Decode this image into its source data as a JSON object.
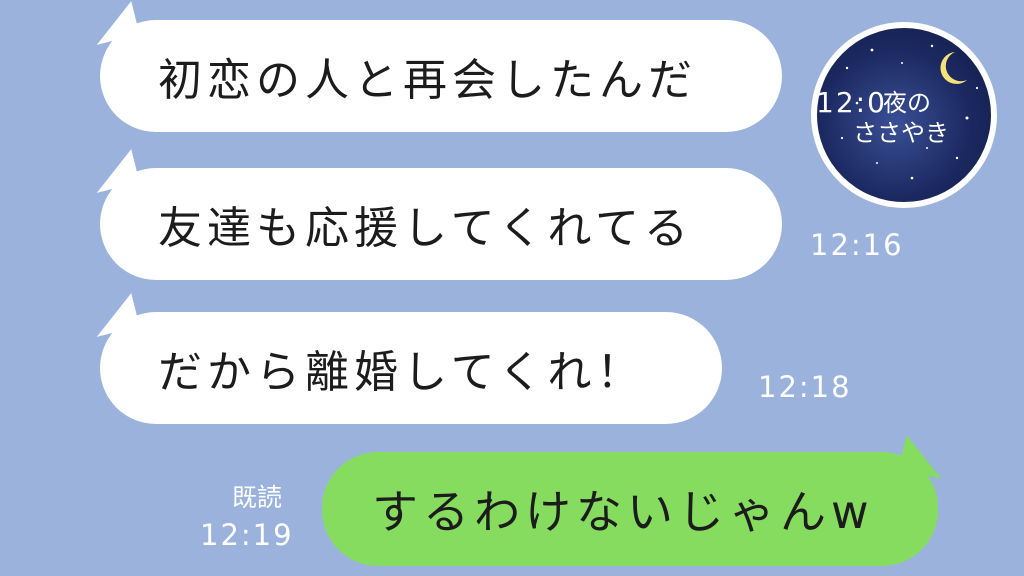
{
  "messages": [
    {
      "text": "初恋の人と再会したんだ",
      "time": "12:0"
    },
    {
      "text": "友達も応援してくれてる",
      "time": "12:16"
    },
    {
      "text": "だから離婚してくれ！",
      "time": "12:18"
    }
  ],
  "reply": {
    "text": "するわけないじゃんw",
    "read_label": "既読",
    "time": "12:19"
  },
  "avatar": {
    "title_line1": "夜の",
    "title_line2": "ささやき",
    "icon": "moon-night-sky-icon"
  },
  "colors": {
    "background": "#9bb3dc",
    "received_bubble": "#ffffff",
    "sent_bubble": "#86dc5f"
  }
}
